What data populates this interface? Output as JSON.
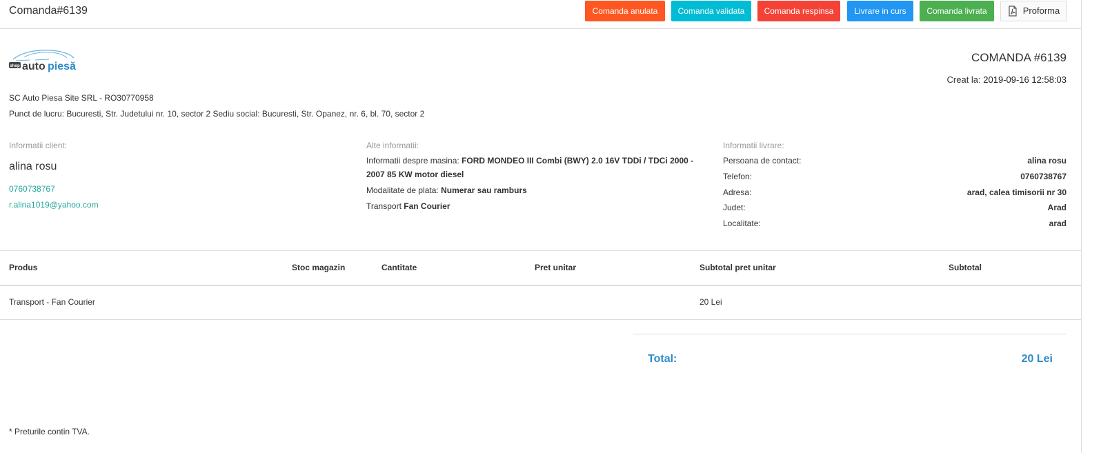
{
  "header": {
    "title": "Comanda#6139",
    "buttons": {
      "anulata": "Comanda anulata",
      "validata": "Comanda validata",
      "respinsa": "Comanda respinsa",
      "livrare": "Livrare in curs",
      "livrata": "Comanda livrata",
      "proforma": "Proforma"
    }
  },
  "logo": {
    "small": "shop",
    "brand_1": "auto",
    "brand_2": "piesă"
  },
  "invoice": {
    "title": "COMANDA #6139",
    "created_label": "Creat la:",
    "created_value": "2019-09-16 12:58:03"
  },
  "company": {
    "name": "SC Auto Piesa Site SRL - RO30770958",
    "address": "Punct de lucru: Bucuresti, Str. Judetului nr. 10, sector 2 Sediu social: Bucuresti, Str. Opanez, nr. 6, bl. 70, sector 2"
  },
  "client": {
    "heading": "Informatii client:",
    "name": "alina rosu",
    "phone": "0760738767",
    "email": "r.alina1019@yahoo.com"
  },
  "other": {
    "heading": "Alte informatii:",
    "car_label": "Informatii despre masina:",
    "car_value": "FORD MONDEO III Combi (BWY) 2.0 16V TDDi / TDCi 2000 - 2007 85 KW motor diesel",
    "payment_label": "Modalitate de plata:",
    "payment_value": "Numerar sau ramburs",
    "transport_label": "Transport",
    "transport_value": "Fan Courier"
  },
  "delivery": {
    "heading": "Informatii livrare:",
    "rows": [
      {
        "label": "Persoana de contact:",
        "value": "alina rosu"
      },
      {
        "label": "Telefon:",
        "value": "0760738767"
      },
      {
        "label": "Adresa:",
        "value": "arad, calea timisorii nr 30"
      },
      {
        "label": "Judet:",
        "value": "Arad"
      },
      {
        "label": "Localitate:",
        "value": "arad"
      }
    ]
  },
  "table": {
    "headers": [
      "Produs",
      "Stoc magazin",
      "Cantitate",
      "Pret unitar",
      "Subtotal pret unitar",
      "Subtotal"
    ],
    "rows": [
      {
        "produs": "Transport - Fan Courier",
        "stoc": "",
        "cantitate": "",
        "pret": "",
        "subtotal_pret": "20 Lei",
        "subtotal": ""
      }
    ]
  },
  "total": {
    "label": "Total:",
    "value": "20 Lei"
  },
  "footnote": "* Preturile contin TVA.",
  "colors": {
    "anulata": "#ff5722",
    "validata": "#00bcd4",
    "respinsa": "#f44336",
    "livrare": "#2196f3",
    "livrata": "#4caf50",
    "link": "#26a69a",
    "total": "#2e8bc9"
  }
}
